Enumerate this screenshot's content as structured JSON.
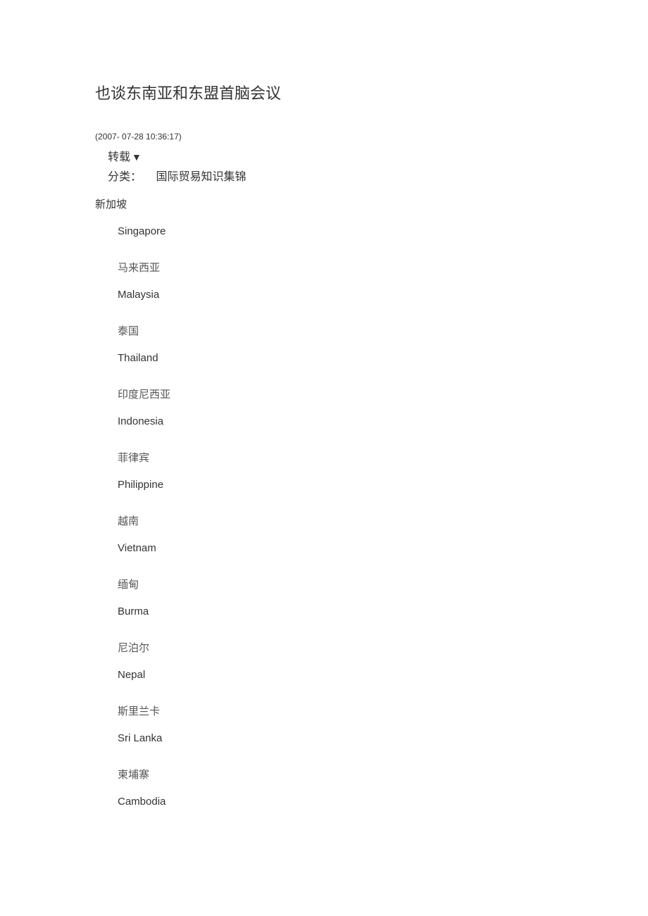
{
  "title": "也谈东南亚和东盟首脑会议",
  "timestamp": "(2007- 07-28 10:36:17)",
  "repost_label": "转载",
  "category_label": "分类：",
  "category_value": "国际贸易知识集锦",
  "first_country_cn": "新加坡",
  "first_country_en": "Singapore",
  "countries": [
    {
      "cn": "马来西亚",
      "en": "Malaysia"
    },
    {
      "cn": "泰国",
      "en": "Thailand"
    },
    {
      "cn": "印度尼西亚",
      "en": "Indonesia"
    },
    {
      "cn": "菲律宾",
      "en": "Philippine"
    },
    {
      "cn": "越南",
      "en": "Vietnam"
    },
    {
      "cn": "缅甸",
      "en": "Burma"
    },
    {
      "cn": "尼泊尔",
      "en": "Nepal"
    },
    {
      "cn": "斯里兰卡",
      "en": "Sri Lanka"
    },
    {
      "cn": "柬埔寨",
      "en": "Cambodia"
    }
  ]
}
